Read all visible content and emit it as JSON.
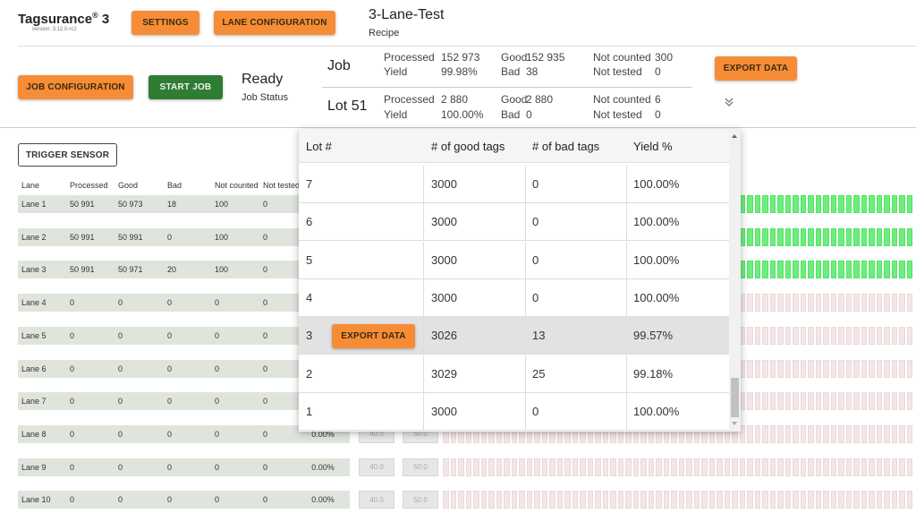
{
  "app": {
    "name": "Tagsurance",
    "reg": "®",
    "major": "3",
    "version": "version: 3.12.0-rc2"
  },
  "toolbar": {
    "settings_label": "SETTINGS",
    "lane_config_label": "LANE CONFIGURATION",
    "job_config_label": "JOB CONFIGURATION",
    "start_job_label": "START JOB",
    "export_label": "EXPORT DATA",
    "trigger_sensor_label": "TRIGGER SENSOR"
  },
  "recipe": {
    "name": "3-Lane-Test",
    "label": "Recipe"
  },
  "job_status": {
    "value": "Ready",
    "label": "Job Status"
  },
  "job_summary": {
    "title": "Job",
    "processed_label": "Processed",
    "processed": "152 973",
    "yield_label": "Yield",
    "yield": "99.98%",
    "good_label": "Good",
    "good": "152 935",
    "bad_label": "Bad",
    "bad": "38",
    "not_counted_label": "Not counted",
    "not_counted": "300",
    "not_tested_label": "Not tested",
    "not_tested": "0"
  },
  "lot_summary": {
    "title": "Lot 51",
    "processed_label": "Processed",
    "processed": "2 880",
    "yield_label": "Yield",
    "yield": "100.00%",
    "good_label": "Good",
    "good": "2 880",
    "bad_label": "Bad",
    "bad": "0",
    "not_counted_label": "Not counted",
    "not_counted": "6",
    "not_tested_label": "Not tested",
    "not_tested": "0"
  },
  "icons": {
    "expand": "chevron-double-down-icon",
    "scroll_up": "arrow-up-icon",
    "scroll_down": "arrow-down-icon"
  },
  "lanes": {
    "headers": [
      "Lane",
      "Processed",
      "Good",
      "Bad",
      "Not counted",
      "Not tested"
    ],
    "rows": [
      {
        "lane": "Lane 1",
        "processed": "50 991",
        "good": "50 973",
        "bad": "18",
        "not_counted": "100",
        "not_tested": "0",
        "active": true
      },
      {
        "lane": "Lane 2",
        "processed": "50 991",
        "good": "50 991",
        "bad": "0",
        "not_counted": "100",
        "not_tested": "0",
        "active": true
      },
      {
        "lane": "Lane 3",
        "processed": "50 991",
        "good": "50 971",
        "bad": "20",
        "not_counted": "100",
        "not_tested": "0",
        "active": true
      },
      {
        "lane": "Lane 4",
        "processed": "0",
        "good": "0",
        "bad": "0",
        "not_counted": "0",
        "not_tested": "0",
        "active": false
      },
      {
        "lane": "Lane 5",
        "processed": "0",
        "good": "0",
        "bad": "0",
        "not_counted": "0",
        "not_tested": "0",
        "active": false
      },
      {
        "lane": "Lane 6",
        "processed": "0",
        "good": "0",
        "bad": "0",
        "not_counted": "0",
        "not_tested": "0",
        "active": false
      },
      {
        "lane": "Lane 7",
        "processed": "0",
        "good": "0",
        "bad": "0",
        "not_counted": "0",
        "not_tested": "0",
        "active": false
      },
      {
        "lane": "Lane 8",
        "processed": "0",
        "good": "0",
        "bad": "0",
        "not_counted": "0",
        "not_tested": "0",
        "active": false,
        "yield": "0.00%",
        "min": "40.0",
        "max": "50.0"
      },
      {
        "lane": "Lane 9",
        "processed": "0",
        "good": "0",
        "bad": "0",
        "not_counted": "0",
        "not_tested": "0",
        "active": false,
        "yield": "0.00%",
        "min": "40.0",
        "max": "50.0"
      },
      {
        "lane": "Lane 10",
        "processed": "0",
        "good": "0",
        "bad": "0",
        "not_counted": "0",
        "not_tested": "0",
        "active": false,
        "yield": "0.00%",
        "min": "40.0",
        "max": "50.0"
      }
    ]
  },
  "lot_table": {
    "headers": [
      "Lot #",
      "# of good tags",
      "# of bad tags",
      "Yield %"
    ],
    "rows": [
      {
        "lot": "7",
        "good": "3000",
        "bad": "0",
        "yield": "100.00%"
      },
      {
        "lot": "6",
        "good": "3000",
        "bad": "0",
        "yield": "100.00%"
      },
      {
        "lot": "5",
        "good": "3000",
        "bad": "0",
        "yield": "100.00%"
      },
      {
        "lot": "4",
        "good": "3000",
        "bad": "0",
        "yield": "100.00%"
      },
      {
        "lot": "3",
        "good": "3026",
        "bad": "13",
        "yield": "99.57%",
        "selected": true,
        "export_label": "EXPORT DATA"
      },
      {
        "lot": "2",
        "good": "3029",
        "bad": "25",
        "yield": "99.18%"
      },
      {
        "lot": "1",
        "good": "3000",
        "bad": "0",
        "yield": "100.00%"
      }
    ]
  },
  "colors": {
    "accent": "#f68d36",
    "start": "#2e7d32",
    "lane_bg": "#dfe5dc",
    "seg_good": "#6af07a",
    "seg_idle": "#f3e6e6"
  }
}
